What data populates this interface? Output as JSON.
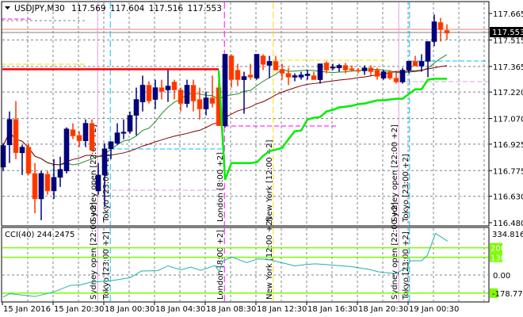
{
  "header": {
    "menu_icon": "triangle-down-icon",
    "symbol": "USDJPY,M30",
    "open": "117.569",
    "high": "117.604",
    "low": "117.516",
    "close": "117.553"
  },
  "price_axis": {
    "labels": [
      "117.665",
      "117.515",
      "117.365",
      "117.220",
      "117.070",
      "116.925",
      "116.775",
      "116.630",
      "116.480"
    ],
    "current_price_label": "117.553",
    "colors": {
      "current_bg": "#000000",
      "current_fg": "#ffffff"
    }
  },
  "time_axis": {
    "labels": [
      "15 Jan 2016",
      "15 Jan 20:30",
      "18 Jan 00:30",
      "18 Jan 04:30",
      "18 Jan 08:30",
      "18 Jan 12:30",
      "18 Jan 16:30",
      "18 Jan 20:30",
      "19 Jan 00:30"
    ]
  },
  "sessions": [
    {
      "label": "Sydney open  [22:00  +2]",
      "bar": 14.9,
      "color": "#dda0dd"
    },
    {
      "label": "Tokyo  [23:00  +2]",
      "bar": 16.9,
      "color": "#00bfff"
    },
    {
      "label": "London  [8:00  +2]",
      "bar": 34.9,
      "color": "#ff00ff"
    },
    {
      "label": "New York  [12:00  +2]",
      "bar": 42.6,
      "color": "#ffd700"
    },
    {
      "label": "Sydney open  [22:00  +2]",
      "bar": 62.4,
      "color": "#dda0dd"
    },
    {
      "label": "Tokyo  [23:00  +2]",
      "bar": 64.1,
      "color": "#00bfff"
    }
  ],
  "cci": {
    "title": "CCI(40) 244.2475",
    "axis_labels": {
      "max": "334.8163",
      "l200": "200",
      "l130": "130",
      "zero": "0.00",
      "min": "-178.7706"
    },
    "levels": [
      200,
      130,
      -133
    ],
    "level_color": "#7cfc00",
    "line_color": "#20b2aa",
    "points": [
      [
        0,
        -162
      ],
      [
        1,
        -137
      ],
      [
        5,
        -158
      ],
      [
        8,
        -124
      ],
      [
        10.6,
        -76
      ],
      [
        12.2,
        -72
      ],
      [
        13.8,
        -53
      ],
      [
        17,
        -42
      ],
      [
        20.1,
        -19
      ],
      [
        21.8,
        29
      ],
      [
        24.4,
        32
      ],
      [
        26,
        67
      ],
      [
        28,
        38
      ],
      [
        29.6,
        57
      ],
      [
        31.2,
        34
      ],
      [
        33.4,
        70
      ],
      [
        34.1,
        23
      ],
      [
        34.6,
        99
      ],
      [
        36,
        133
      ],
      [
        38.4,
        91
      ],
      [
        40.2,
        118
      ],
      [
        41.8,
        114
      ],
      [
        43.9,
        91
      ],
      [
        46,
        67
      ],
      [
        47.6,
        76
      ],
      [
        49.2,
        82
      ],
      [
        51,
        76
      ],
      [
        55,
        61
      ],
      [
        57.6,
        42
      ],
      [
        59.2,
        23
      ],
      [
        61.9,
        10
      ],
      [
        63.8,
        57
      ],
      [
        64.2,
        105
      ],
      [
        66,
        105
      ],
      [
        66.9,
        143
      ],
      [
        68.2,
        305
      ],
      [
        70.1,
        248
      ]
    ]
  },
  "chart_data": {
    "type": "candlestick",
    "title": "USDJPY,M30",
    "ylim": [
      116.48,
      117.7
    ],
    "colors": {
      "bull": "#000080",
      "bear": "#ff3300",
      "ma_fast": "#228b22",
      "ma_slow": "#800000",
      "vwap": "#00ee00",
      "resistance": "#ff0000"
    },
    "ohlc": [
      [
        116.795,
        116.93,
        116.773,
        116.917
      ],
      [
        116.921,
        117.11,
        116.818,
        117.065
      ],
      [
        117.065,
        117.169,
        116.84,
        116.876
      ],
      [
        116.876,
        116.921,
        116.75,
        116.908
      ],
      [
        116.908,
        116.93,
        116.75,
        116.759
      ],
      [
        116.759,
        116.818,
        116.534,
        116.615
      ],
      [
        116.615,
        116.773,
        116.494,
        116.759
      ],
      [
        116.755,
        116.773,
        116.638,
        116.66
      ],
      [
        116.66,
        116.84,
        116.615,
        116.737
      ],
      [
        116.737,
        116.854,
        116.683,
        116.782
      ],
      [
        116.773,
        117.02,
        116.759,
        117.011
      ],
      [
        117.007,
        117.043,
        116.953,
        116.971
      ],
      [
        116.975,
        116.998,
        116.908,
        116.944
      ],
      [
        116.944,
        117.065,
        116.908,
        117.043
      ],
      [
        117.043,
        117.065,
        116.885,
        116.89
      ],
      [
        116.66,
        116.818,
        116.638,
        116.75
      ],
      [
        116.75,
        116.93,
        116.57,
        116.899
      ],
      [
        116.899,
        116.939,
        116.84,
        116.939
      ],
      [
        116.93,
        117.043,
        116.921,
        116.989
      ],
      [
        116.989,
        117.065,
        116.953,
        116.993
      ],
      [
        116.998,
        117.11,
        116.984,
        117.088
      ],
      [
        117.088,
        117.245,
        116.975,
        117.178
      ],
      [
        117.164,
        117.313,
        117.11,
        117.259
      ],
      [
        117.259,
        117.281,
        117.155,
        117.169
      ],
      [
        117.178,
        117.29,
        117.124,
        117.245
      ],
      [
        117.245,
        117.29,
        117.178,
        117.223
      ],
      [
        117.232,
        117.344,
        117.164,
        117.254
      ],
      [
        117.277,
        117.29,
        117.178,
        117.232
      ],
      [
        117.232,
        117.245,
        117.11,
        117.155
      ],
      [
        117.155,
        117.29,
        117.133,
        117.259
      ],
      [
        117.259,
        117.29,
        117.11,
        117.169
      ],
      [
        117.178,
        117.245,
        117.065,
        117.124
      ],
      [
        117.124,
        117.223,
        117.088,
        117.187
      ],
      [
        117.187,
        117.313,
        117.133,
        117.155
      ],
      [
        117.245,
        117.29,
        117.029,
        117.029
      ],
      [
        117.029,
        117.434,
        117.02,
        117.434
      ],
      [
        117.425,
        117.434,
        117.245,
        117.29
      ],
      [
        117.344,
        117.38,
        117.254,
        117.29
      ],
      [
        117.29,
        117.335,
        117.097,
        117.308
      ],
      [
        117.317,
        117.38,
        117.29,
        117.304
      ],
      [
        117.299,
        117.434,
        117.29,
        117.434
      ],
      [
        117.425,
        117.434,
        117.344,
        117.376
      ],
      [
        117.371,
        117.425,
        117.299,
        117.394
      ],
      [
        117.394,
        117.425,
        117.344,
        117.344
      ],
      [
        117.349,
        117.38,
        117.29,
        117.326
      ],
      [
        117.326,
        117.357,
        117.259,
        117.304
      ],
      [
        117.304,
        117.326,
        117.281,
        117.313
      ],
      [
        117.304,
        117.335,
        117.29,
        117.317
      ],
      [
        117.313,
        117.344,
        117.29,
        117.322
      ],
      [
        117.313,
        117.335,
        117.29,
        117.29
      ],
      [
        117.29,
        117.38,
        117.268,
        117.38
      ],
      [
        117.385,
        117.394,
        117.326,
        117.344
      ],
      [
        117.357,
        117.38,
        117.344,
        117.362
      ],
      [
        117.357,
        117.38,
        117.335,
        117.371
      ],
      [
        117.371,
        117.385,
        117.326,
        117.344
      ],
      [
        117.353,
        117.371,
        117.335,
        117.344
      ],
      [
        117.344,
        117.357,
        117.326,
        117.34
      ],
      [
        117.34,
        117.371,
        117.317,
        117.357
      ],
      [
        117.357,
        117.371,
        117.313,
        117.335
      ],
      [
        117.344,
        117.357,
        117.29,
        117.308
      ],
      [
        117.299,
        117.344,
        117.29,
        117.335
      ],
      [
        117.335,
        117.344,
        117.29,
        117.299
      ],
      [
        117.299,
        117.335,
        117.268,
        117.277
      ],
      [
        117.277,
        117.357,
        117.268,
        117.344
      ],
      [
        117.344,
        117.394,
        117.326,
        117.394
      ],
      [
        117.394,
        117.425,
        117.371,
        117.367
      ],
      [
        117.367,
        117.434,
        117.335,
        117.394
      ],
      [
        117.394,
        117.506,
        117.304,
        117.506
      ],
      [
        117.506,
        117.659,
        117.48,
        117.618
      ],
      [
        117.614,
        117.64,
        117.506,
        117.573
      ],
      [
        117.569,
        117.604,
        117.516,
        117.553
      ]
    ],
    "vwap_start_bar": 34,
    "vwap": [
      117.344,
      116.723,
      116.818,
      116.818,
      116.818,
      116.818,
      116.822,
      116.858,
      116.885,
      116.894,
      116.903,
      116.953,
      116.998,
      117.002,
      117.065,
      117.074,
      117.079,
      117.11,
      117.119,
      117.133,
      117.137,
      117.142,
      117.151,
      117.155,
      117.164,
      117.173,
      117.173,
      117.178,
      117.182,
      117.182,
      117.209,
      117.236,
      117.236,
      117.29,
      117.295,
      117.295,
      117.295
    ],
    "resistance_level": 117.349,
    "resistance_end_bar": 34
  }
}
